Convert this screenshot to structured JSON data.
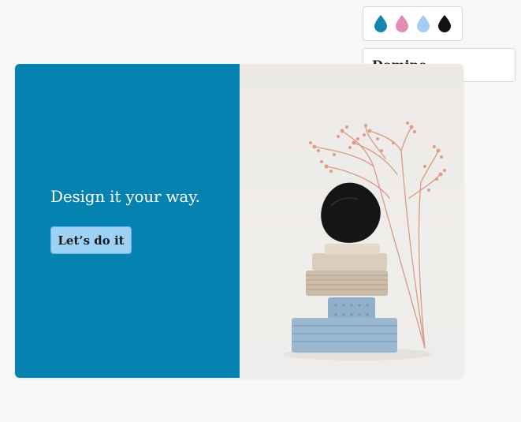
{
  "palette": {
    "swatches": [
      {
        "name": "teal",
        "color": "#1785ad"
      },
      {
        "name": "pink",
        "color": "#e58cb6"
      },
      {
        "name": "light-blue",
        "color": "#a3cdf2"
      },
      {
        "name": "black",
        "color": "#111111"
      }
    ]
  },
  "font_picker": {
    "value": "Domine"
  },
  "hero": {
    "headline": "Design it your way.",
    "cta_label": "Let’s do it",
    "panel_color": "#0582b0",
    "button_color": "#9ed2f5",
    "image_icon": "stacked-ceramics-photo"
  }
}
